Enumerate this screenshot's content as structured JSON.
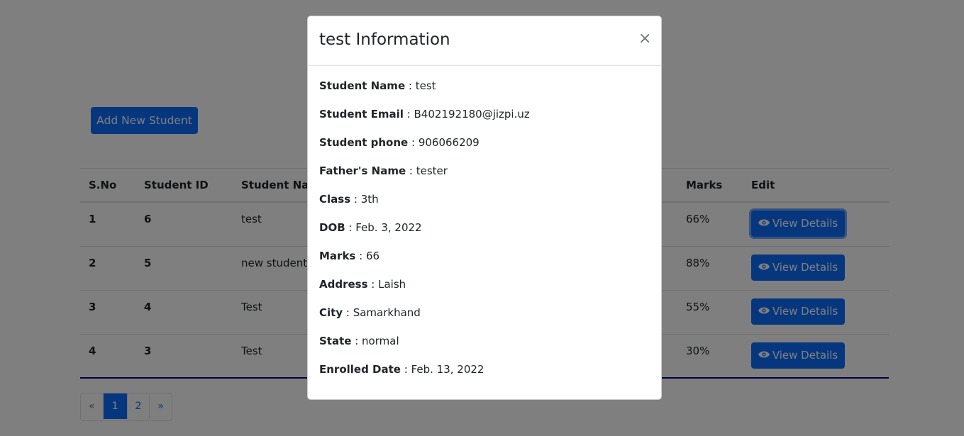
{
  "page": {
    "add_button": "Add New Student",
    "table": {
      "headers": [
        "S.No",
        "Student ID",
        "Student Nam",
        "Marks",
        "Edit"
      ],
      "rows": [
        {
          "sno": "1",
          "id": "6",
          "name": "test",
          "marks": "66%",
          "action": "View Details"
        },
        {
          "sno": "2",
          "id": "5",
          "name": "new student",
          "marks": "88%",
          "action": "View Details"
        },
        {
          "sno": "3",
          "id": "4",
          "name": "Test",
          "marks": "55%",
          "action": "View Details"
        },
        {
          "sno": "4",
          "id": "3",
          "name": "Test",
          "marks": "30%",
          "action": "View Details"
        }
      ]
    },
    "pagination": {
      "prev": "«",
      "pages": [
        "1",
        "2"
      ],
      "next": "»",
      "active_page": "1"
    }
  },
  "modal": {
    "title": "test Information",
    "close": "×",
    "fields": [
      {
        "label": "Student Name",
        "value": "test"
      },
      {
        "label": "Student Email",
        "value": "B402192180@jizpi.uz"
      },
      {
        "label": "Student phone",
        "value": "906066209"
      },
      {
        "label": "Father's Name",
        "value": "tester"
      },
      {
        "label": "Class",
        "value": "3th"
      },
      {
        "label": "DOB",
        "value": "Feb. 3, 2022"
      },
      {
        "label": "Marks",
        "value": "66"
      },
      {
        "label": "Address",
        "value": "Laish"
      },
      {
        "label": "City",
        "value": "Samarkhand"
      },
      {
        "label": "State",
        "value": "normal"
      },
      {
        "label": "Enrolled Date",
        "value": "Feb. 13, 2022"
      }
    ]
  },
  "colors": {
    "primary": "#0d6efd",
    "backdrop": "rgba(0,0,0,0.5)",
    "table_bottom_border": "#00008b"
  },
  "icons": {
    "view_button_icon": "eye-icon",
    "close_icon": "close-icon"
  }
}
